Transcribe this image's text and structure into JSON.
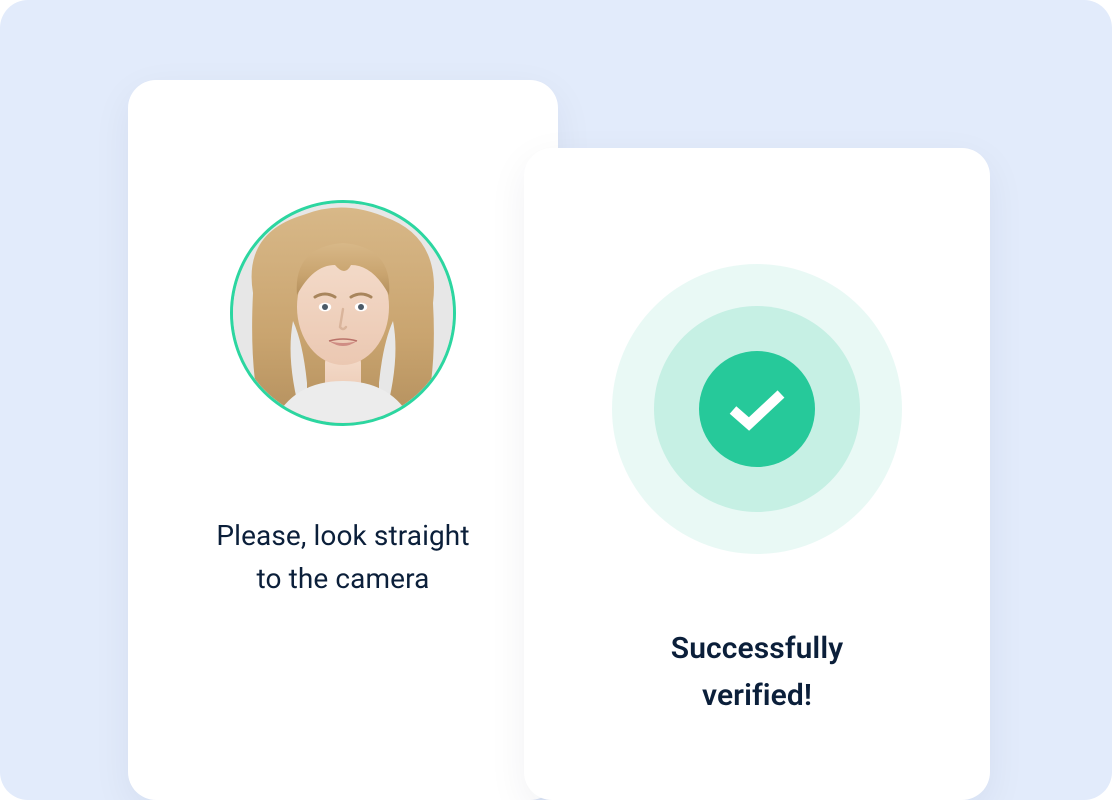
{
  "colors": {
    "background": "#e2ebfb",
    "card": "#ffffff",
    "text": "#0b1f3a",
    "accent": "#26c99a",
    "avatar_ring": "#2cd6a0"
  },
  "card_camera": {
    "instruction_line1": "Please, look straight",
    "instruction_line2": "to the camera",
    "avatar_icon": "person-photo-icon"
  },
  "card_verified": {
    "title_line1": "Successfully",
    "title_line2": "verified!",
    "icon": "check-icon"
  }
}
